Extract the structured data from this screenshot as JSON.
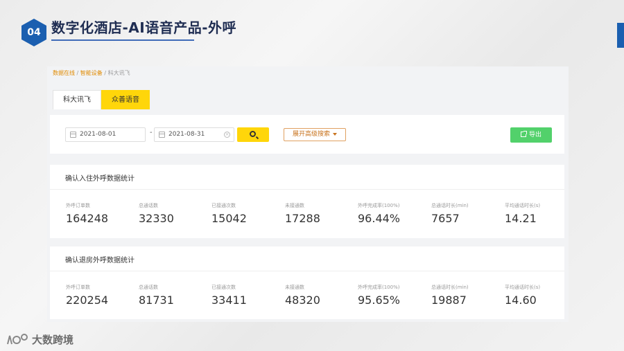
{
  "slide": {
    "badge_number": "04",
    "title": "数字化酒店-AI语音产品-外呼"
  },
  "breadcrumb": {
    "items": [
      "数据在线",
      "智能设备",
      "科大讯飞"
    ],
    "separator": "/"
  },
  "tabs": [
    {
      "label": "科大讯飞",
      "active": false
    },
    {
      "label": "众善语音",
      "active": true
    }
  ],
  "filters": {
    "start_date": "2021-08-01",
    "end_date": "2021-08-31",
    "range_separator": "-",
    "advanced_label": "展开高级搜索",
    "export_label": "导出"
  },
  "checkin_stats": {
    "title": "确认入住外呼数据统计",
    "metrics": [
      {
        "label": "外呼订单数",
        "value": "164248"
      },
      {
        "label": "总通话数",
        "value": "32330"
      },
      {
        "label": "已接通次数",
        "value": "15042"
      },
      {
        "label": "未接通数",
        "value": "17288"
      },
      {
        "label": "外呼完成率(100%)",
        "value": "96.44%"
      },
      {
        "label": "总通话时长(min)",
        "value": "7657"
      },
      {
        "label": "平均通话时长(s)",
        "value": "14.21"
      }
    ]
  },
  "checkout_stats": {
    "title": "确认退房外呼数据统计",
    "metrics": [
      {
        "label": "外呼订单数",
        "value": "220254"
      },
      {
        "label": "总通话数",
        "value": "81731"
      },
      {
        "label": "已接通次数",
        "value": "33411"
      },
      {
        "label": "未接通数",
        "value": "48320"
      },
      {
        "label": "外呼完成率(100%)",
        "value": "95.65%"
      },
      {
        "label": "总通话时长(min)",
        "value": "19887"
      },
      {
        "label": "平均通话时长(s)",
        "value": "14.60"
      }
    ]
  },
  "footer": {
    "logo_text": "大数跨境"
  },
  "colors": {
    "accent_yellow": "#ffd60a",
    "export_green": "#52d16b",
    "badge_blue": "#1b5fb0",
    "title_navy": "#1f2d52"
  }
}
